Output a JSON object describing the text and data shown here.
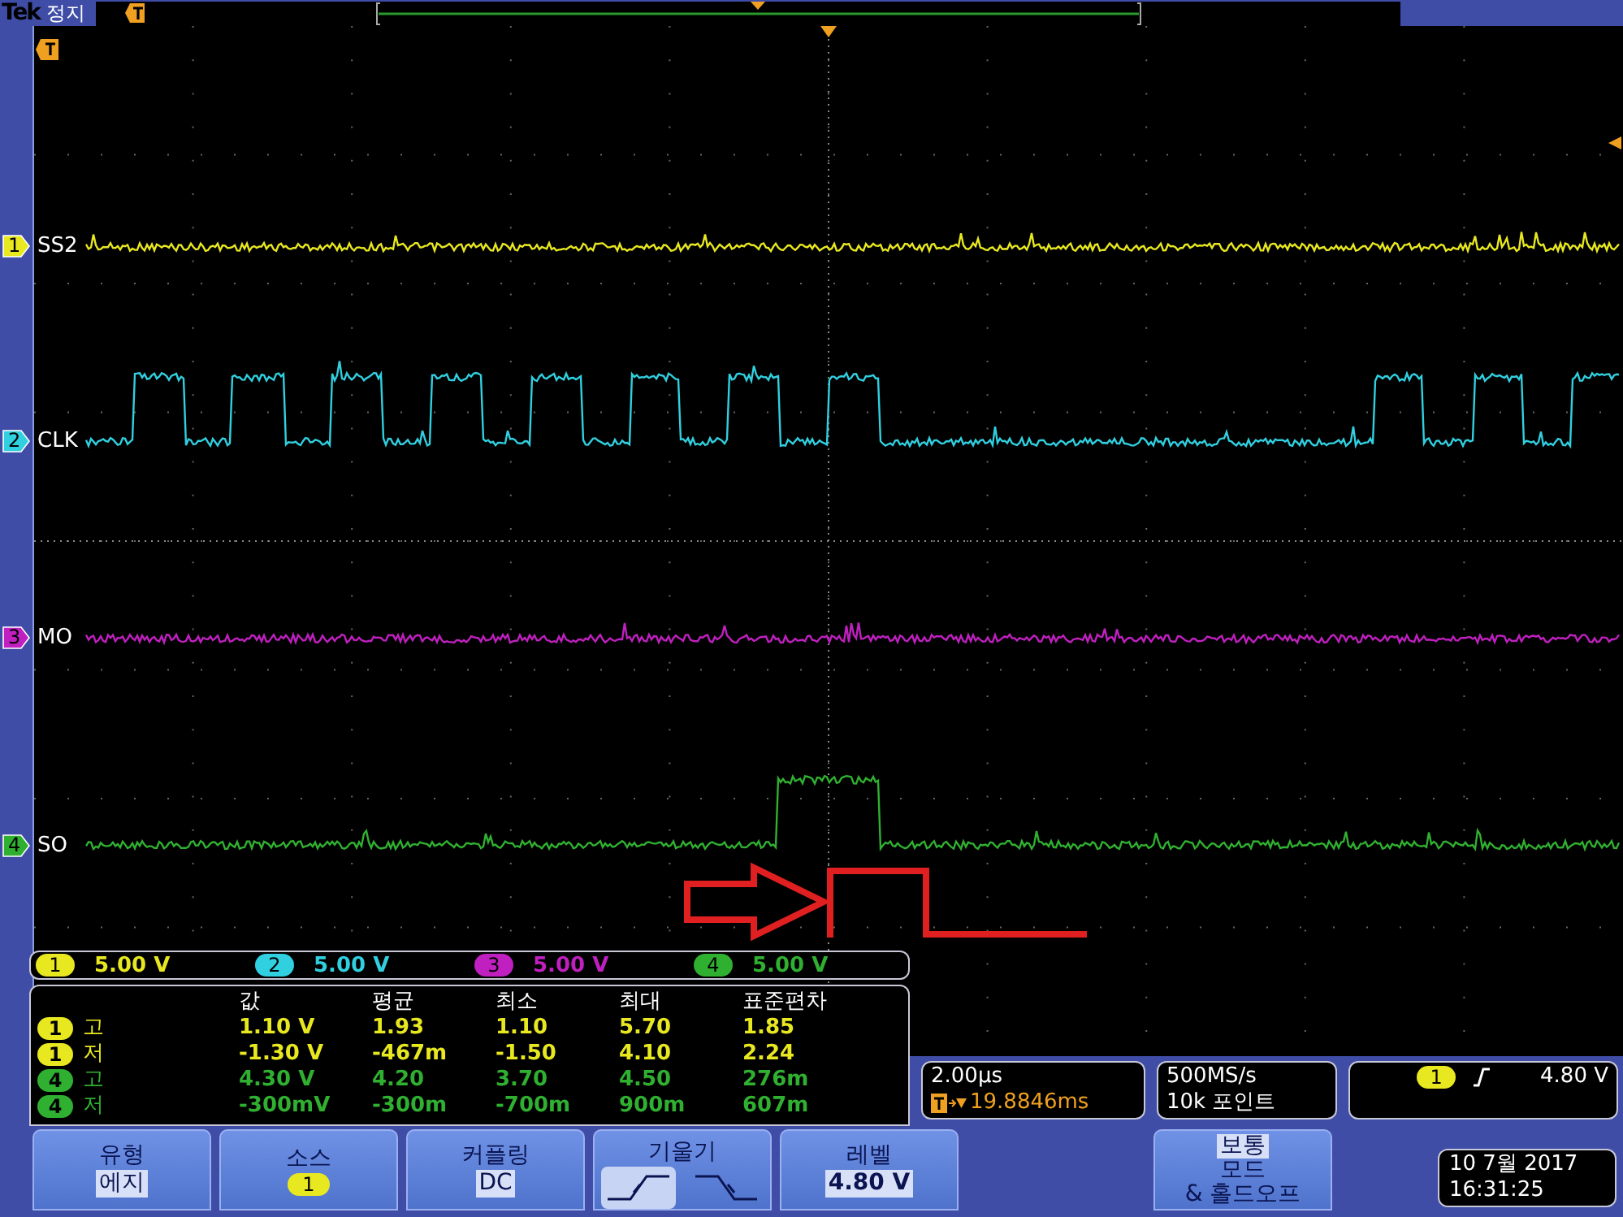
{
  "header": {
    "brand": "Tek",
    "status": "정지"
  },
  "channels": [
    {
      "number": "1",
      "label": "SS2",
      "color": "#e8e820",
      "scale_number": "1",
      "scale": "5.00 V"
    },
    {
      "number": "2",
      "label": "CLK",
      "color": "#30d0e0",
      "scale_number": "2",
      "scale": "5.00 V"
    },
    {
      "number": "3",
      "label": "MO",
      "color": "#c020c0",
      "scale_number": "3",
      "scale": "5.00 V"
    },
    {
      "number": "4",
      "label": "SO",
      "color": "#30b030",
      "scale_number": "4",
      "scale": "5.00 V"
    }
  ],
  "measurements": {
    "columns": [
      "값",
      "평균",
      "최소",
      "최대",
      "표준편차"
    ],
    "rows": [
      {
        "channel": "1",
        "color": "#e8e820",
        "name": "고",
        "values": [
          "1.10 V",
          "1.93",
          "1.10",
          "5.70",
          "1.85"
        ]
      },
      {
        "channel": "1",
        "color": "#e8e820",
        "name": "저",
        "values": [
          "-1.30 V",
          "-467m",
          "-1.50",
          "4.10",
          "2.24"
        ]
      },
      {
        "channel": "4",
        "color": "#30b030",
        "name": "고",
        "values": [
          "4.30 V",
          "4.20",
          "3.70",
          "4.50",
          "276m"
        ]
      },
      {
        "channel": "4",
        "color": "#30b030",
        "name": "저",
        "values": [
          "-300mV",
          "-300m",
          "-700m",
          "900m",
          "607m"
        ]
      }
    ]
  },
  "timebase": {
    "scale": "2.00µs",
    "position": "19.8846ms"
  },
  "acquisition": {
    "rate": "500MS/s",
    "record": "10k 포인트"
  },
  "trigger": {
    "source": "1",
    "level": "4.80 V"
  },
  "menu": [
    {
      "kind": "text",
      "title": "유형",
      "value": "에지"
    },
    {
      "kind": "source",
      "title": "소스",
      "value": "1"
    },
    {
      "kind": "text",
      "title": "커플링",
      "value": "DC"
    },
    {
      "kind": "slope",
      "title": "기울기",
      "slopes": [
        {
          "kind": "rising",
          "selected": true
        },
        {
          "kind": "falling",
          "selected": false
        }
      ]
    },
    {
      "kind": "text",
      "title": "레벨",
      "value": "4.80 V"
    }
  ],
  "mode_button": {
    "lines": [
      {
        "text": "보통",
        "selected": true
      },
      {
        "text": "모드",
        "selected": false
      },
      {
        "text": "& 홀드오프",
        "selected": false
      }
    ]
  },
  "datetime": {
    "date": "10 7월 2017",
    "time": "16:31:25"
  }
}
